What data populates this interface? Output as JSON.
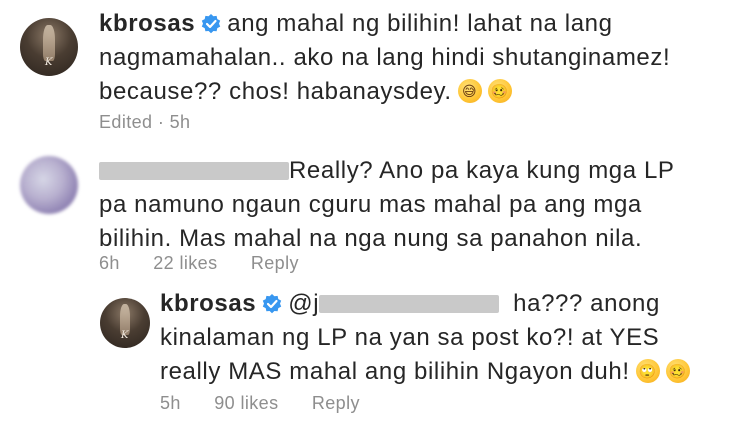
{
  "comment1": {
    "username": "kbrosas",
    "verified": true,
    "avatar_text": "K",
    "lines": [
      "ang mahal ng bilihin! lahat na lang",
      "nagmamahalan.. ako na lang hindi shutanginamez!",
      "because?? chos! habanaysdey."
    ],
    "emojis": [
      "smiling-face-with-sweat-icon",
      "woozy-face-icon"
    ],
    "meta": {
      "edited": "Edited · 5h"
    }
  },
  "comment2": {
    "username_redacted": true,
    "lines": [
      "Really? Ano pa kaya kung mga LP",
      "pa namuno ngaun cguru mas mahal pa ang mga",
      "bilihin. Mas mahal na nga nung sa panahon nila."
    ],
    "meta": {
      "time": "6h",
      "likes": "22 likes",
      "reply": "Reply"
    }
  },
  "reply1": {
    "username": "kbrosas",
    "verified": true,
    "avatar_text": "K",
    "mention_prefix": "@j",
    "lines": [
      "ha??? anong",
      "kinalaman ng LP na yan sa post ko?! at YES",
      "really MAS mahal ang bilihin Ngayon duh!"
    ],
    "emojis": [
      "face-with-rolling-eyes-icon",
      "woozy-face-icon"
    ],
    "meta": {
      "time": "5h",
      "likes": "90 likes",
      "reply": "Reply"
    }
  },
  "colors": {
    "text": "#262626",
    "meta": "#8e8e8e",
    "verified": "#3897f0",
    "background": "#ffffff"
  }
}
